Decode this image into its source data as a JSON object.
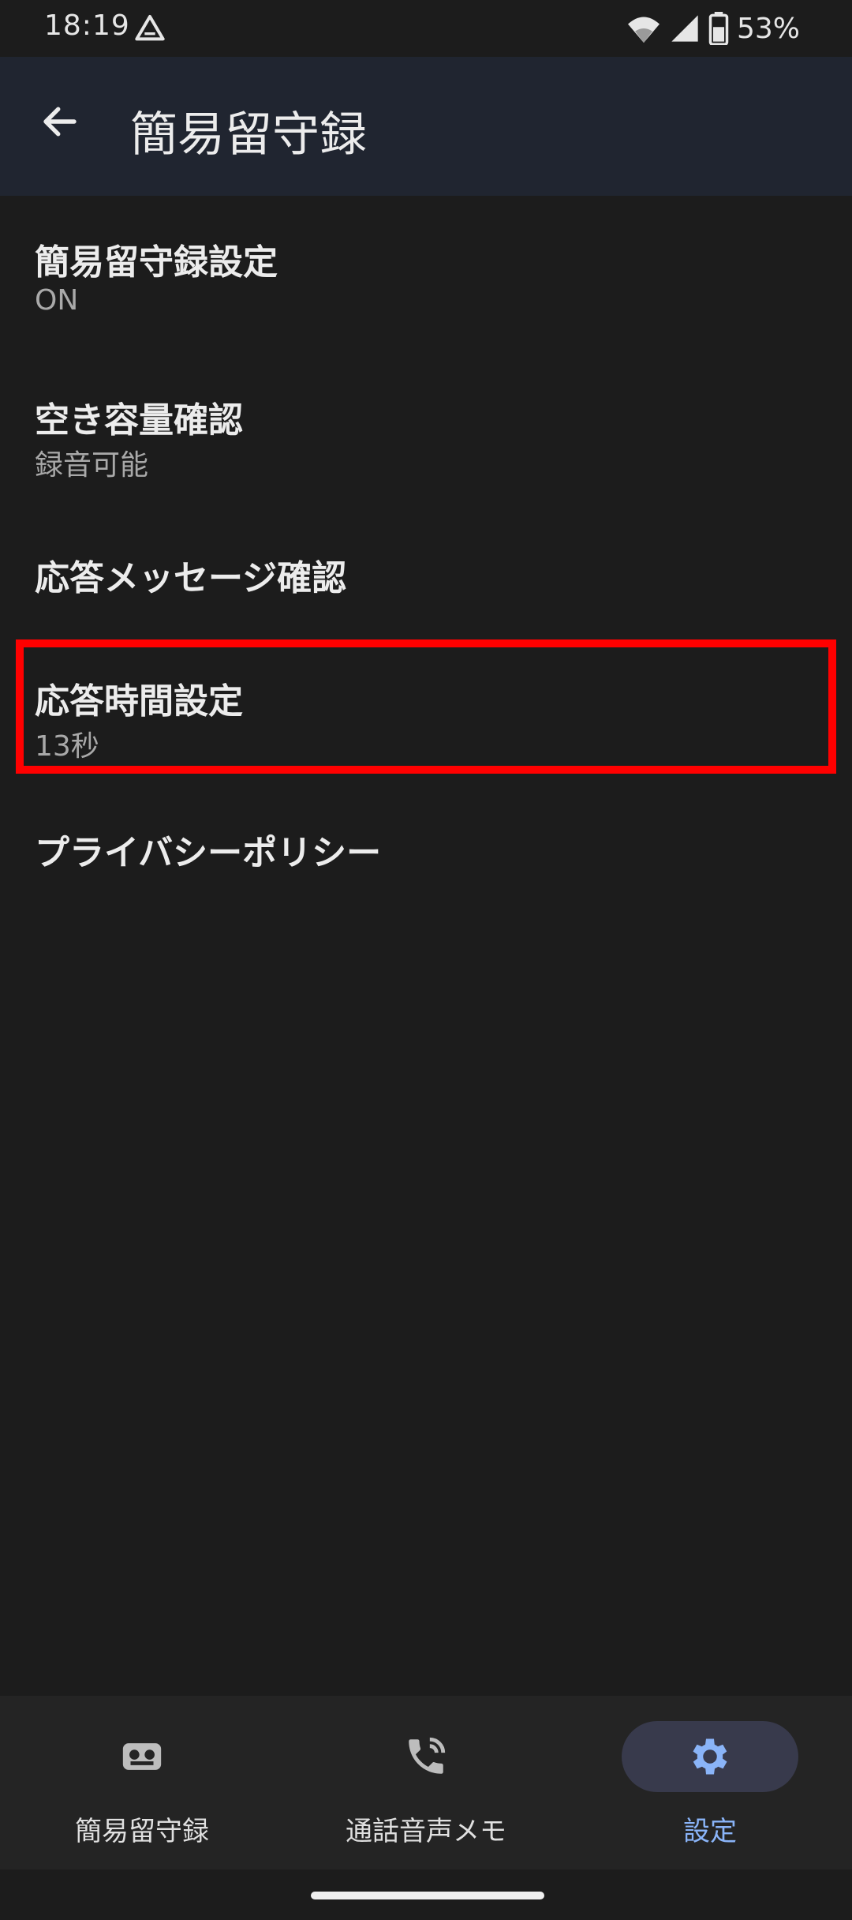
{
  "status_bar": {
    "time": "18:19",
    "battery": "53%",
    "icons": [
      "drive-icon",
      "wifi-icon",
      "signal-icon",
      "battery-icon"
    ]
  },
  "app_bar": {
    "title": "簡易留守録",
    "back_icon": "arrow-left-icon"
  },
  "settings": [
    {
      "title": "簡易留守録設定",
      "summary": "ON"
    },
    {
      "title": "空き容量確認",
      "summary": "録音可能"
    },
    {
      "title": "応答メッセージ確認",
      "summary": ""
    },
    {
      "title": "応答時間設定",
      "summary": "13秒"
    },
    {
      "title": "プライバシーポリシー",
      "summary": ""
    }
  ],
  "bottom_nav": {
    "items": [
      {
        "label": "簡易留守録",
        "icon": "voicemail-icon",
        "active": false
      },
      {
        "label": "通話音声メモ",
        "icon": "phone-call-icon",
        "active": false
      },
      {
        "label": "設定",
        "icon": "gear-icon",
        "active": true
      }
    ]
  },
  "colors": {
    "background": "#1c1c1c",
    "app_bar": "#202530",
    "accent": "#8ab4f8",
    "highlight_box": "#ff0000"
  }
}
